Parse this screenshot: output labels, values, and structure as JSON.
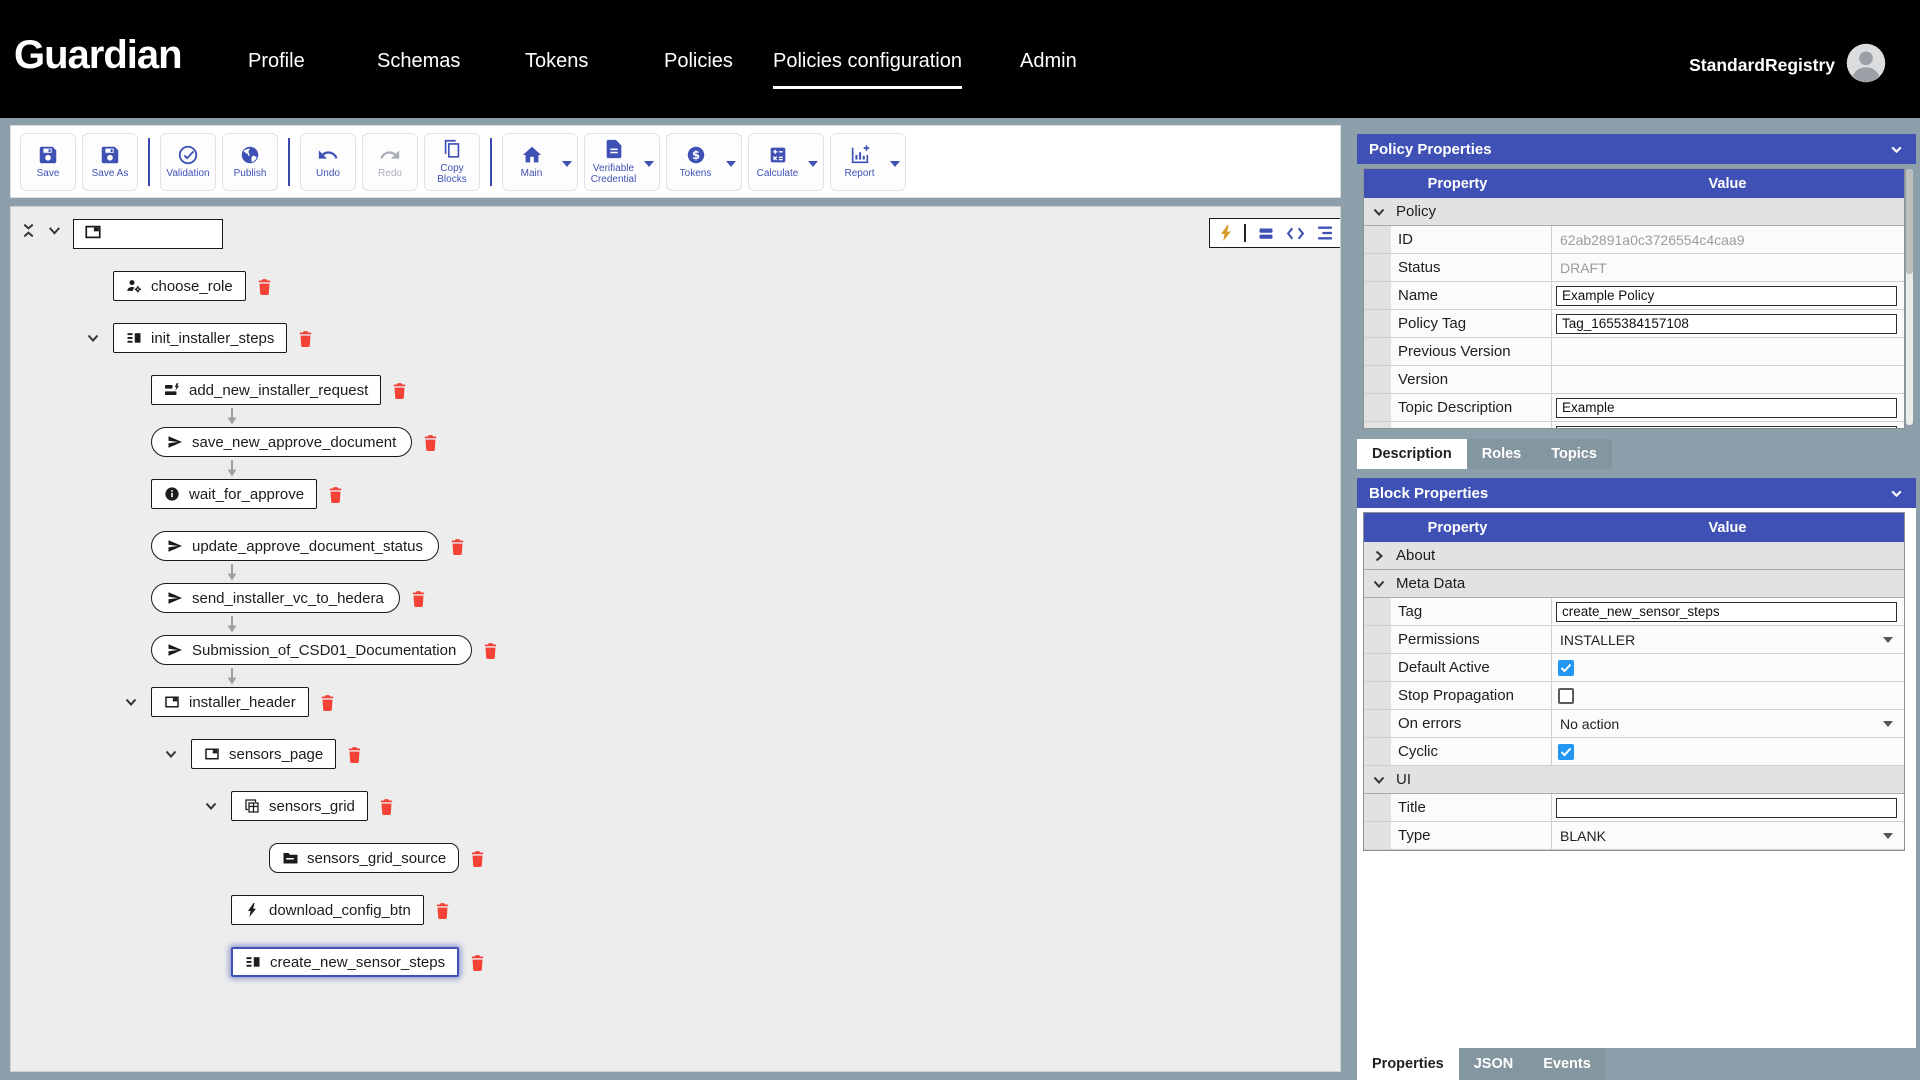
{
  "nav": {
    "logo": "Guardian",
    "items": [
      {
        "label": "Profile"
      },
      {
        "label": "Schemas"
      },
      {
        "label": "Tokens"
      },
      {
        "label": "Policies"
      },
      {
        "label": "Policies configuration",
        "active": true
      },
      {
        "label": "Admin"
      }
    ],
    "user": "StandardRegistry"
  },
  "toolbar": {
    "groups": [
      [
        {
          "label": "Save",
          "icon": "save"
        },
        {
          "label": "Save As",
          "icon": "save"
        }
      ],
      [
        {
          "label": "Validation",
          "icon": "check-circle"
        },
        {
          "label": "Publish",
          "icon": "globe"
        }
      ],
      [
        {
          "label": "Undo",
          "icon": "undo"
        },
        {
          "label": "Redo",
          "icon": "redo",
          "disabled": true
        },
        {
          "label": "Copy Blocks",
          "icon": "copy"
        }
      ],
      [
        {
          "label": "Main",
          "icon": "home",
          "dropdown": true
        },
        {
          "label": "Verifiable Credential",
          "icon": "document",
          "dropdown": true
        },
        {
          "label": "Tokens",
          "icon": "dollar",
          "dropdown": true
        },
        {
          "label": "Calculate",
          "icon": "calculate",
          "dropdown": true
        },
        {
          "label": "Report",
          "icon": "report",
          "dropdown": true
        }
      ]
    ]
  },
  "canvas": {
    "controls": {
      "collapse_icon": "unfold-less",
      "expand_icon": "chevron-down"
    },
    "root_block": {
      "icon": "tab",
      "label": ""
    },
    "mode_controls": [
      "bolt",
      "blocks-view",
      "code-view",
      "tree-view"
    ],
    "tree": [
      {
        "label": "choose_role",
        "icon": "roles",
        "shape": "rect",
        "depth": 0
      },
      {
        "label": "init_installer_steps",
        "icon": "steps",
        "shape": "rect",
        "depth": 0,
        "expander": true
      },
      {
        "label": "add_new_installer_request",
        "icon": "request",
        "shape": "rect",
        "depth": 1
      },
      {
        "label": "save_new_approve_document",
        "icon": "send",
        "shape": "pill",
        "depth": 1,
        "arrow": true
      },
      {
        "label": "wait_for_approve",
        "icon": "info",
        "shape": "rect",
        "depth": 1,
        "arrow": true
      },
      {
        "label": "update_approve_document_status",
        "icon": "send",
        "shape": "pill",
        "depth": 1
      },
      {
        "label": "send_installer_vc_to_hedera",
        "icon": "send",
        "shape": "pill",
        "depth": 1,
        "arrow": true
      },
      {
        "label": "Submission_of_CSD01_Documentation",
        "icon": "send",
        "shape": "pill",
        "depth": 1,
        "arrow": true
      },
      {
        "label": "installer_header",
        "icon": "tab",
        "shape": "rect",
        "depth": 1,
        "expander": true,
        "arrow": true
      },
      {
        "label": "sensors_page",
        "icon": "tab",
        "shape": "rect",
        "depth": 2,
        "expander": true
      },
      {
        "label": "sensors_grid",
        "icon": "grid",
        "shape": "rect",
        "depth": 3,
        "expander": true
      },
      {
        "label": "sensors_grid_source",
        "icon": "folder",
        "shape": "round",
        "depth": 4
      },
      {
        "label": "download_config_btn",
        "icon": "bolt-black",
        "shape": "rect",
        "depth": 3
      },
      {
        "label": "create_new_sensor_steps",
        "icon": "steps",
        "shape": "rect",
        "depth": 3,
        "selected": true
      }
    ]
  },
  "policy_panel": {
    "title": "Policy Properties",
    "columns": [
      "Property",
      "Value"
    ],
    "group": "Policy",
    "rows": [
      {
        "label": "ID",
        "type": "readonly",
        "value": "62ab2891a0c3726554c4caa9"
      },
      {
        "label": "Status",
        "type": "readonly",
        "value": "DRAFT"
      },
      {
        "label": "Name",
        "type": "input",
        "value": "Example Policy"
      },
      {
        "label": "Policy Tag",
        "type": "input",
        "value": "Tag_1655384157108"
      },
      {
        "label": "Previous Version",
        "type": "text",
        "value": ""
      },
      {
        "label": "Version",
        "type": "text",
        "value": ""
      },
      {
        "label": "Topic Description",
        "type": "input",
        "value": "Example"
      },
      {
        "label": "",
        "type": "input",
        "value": ""
      }
    ],
    "tabs": [
      {
        "label": "Description",
        "active": true
      },
      {
        "label": "Roles"
      },
      {
        "label": "Topics"
      }
    ]
  },
  "block_panel": {
    "title": "Block Properties",
    "columns": [
      "Property",
      "Value"
    ],
    "groups": [
      {
        "label": "About",
        "collapsed": true,
        "rows": []
      },
      {
        "label": "Meta Data",
        "rows": [
          {
            "label": "Tag",
            "type": "input",
            "value": "create_new_sensor_steps"
          },
          {
            "label": "Permissions",
            "type": "select",
            "value": "INSTALLER"
          },
          {
            "label": "Default Active",
            "type": "checkbox",
            "checked": true
          },
          {
            "label": "Stop Propagation",
            "type": "checkbox",
            "checked": false
          },
          {
            "label": "On errors",
            "type": "select",
            "value": "No action"
          },
          {
            "label": "Cyclic",
            "type": "checkbox",
            "checked": true
          }
        ]
      },
      {
        "label": "UI",
        "rows": [
          {
            "label": "Title",
            "type": "input",
            "value": ""
          },
          {
            "label": "Type",
            "type": "select",
            "value": "BLANK"
          }
        ]
      }
    ],
    "tabs": [
      {
        "label": "Properties",
        "active": true
      },
      {
        "label": "JSON"
      },
      {
        "label": "Events"
      }
    ]
  },
  "colors": {
    "accent": "#3F51B5",
    "frame": "#8C9FAA",
    "delete_red": "#F44336",
    "checkbox_blue": "#2196F3",
    "selected_outline": "#3F51B5",
    "bolt_gold": "#D79B2B"
  }
}
